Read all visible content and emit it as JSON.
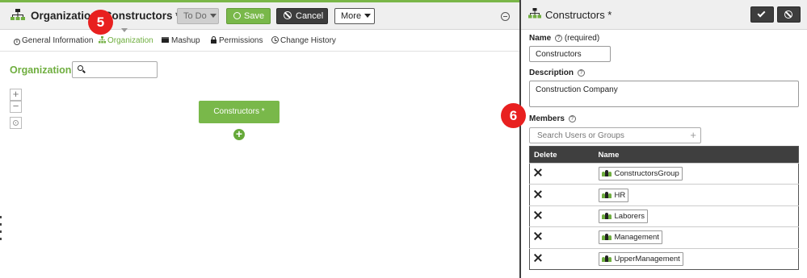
{
  "left": {
    "title": "Organization: Constructors *",
    "buttons": {
      "status": "To Do",
      "save": "Save",
      "cancel": "Cancel",
      "more": "More"
    },
    "tabs": [
      {
        "label": "General Information",
        "icon": "info-icon"
      },
      {
        "label": "Organization",
        "icon": "org-chart-icon",
        "active": true
      },
      {
        "label": "Mashup",
        "icon": "mashup-icon"
      },
      {
        "label": "Permissions",
        "icon": "lock-icon"
      },
      {
        "label": "Change History",
        "icon": "clock-icon"
      }
    ],
    "section_title": "Organization",
    "search_value": "",
    "node_label": "Constructors *"
  },
  "callouts": {
    "step5": "5",
    "step6": "6"
  },
  "right": {
    "title": "Constructors *",
    "name_label": "Name",
    "name_required": "(required)",
    "name_value": "Constructors",
    "description_label": "Description",
    "description_value": "Construction Company",
    "members_label": "Members",
    "members_search_placeholder": "Search Users or Groups",
    "table": {
      "headers": [
        "Delete",
        "Name"
      ],
      "rows": [
        "ConstructorsGroup",
        "HR",
        "Laborers",
        "Management",
        "UpperManagement"
      ]
    }
  },
  "colors": {
    "accent_green": "#79b84a",
    "dark": "#3d3d3d",
    "callout_red": "#e8201f"
  }
}
